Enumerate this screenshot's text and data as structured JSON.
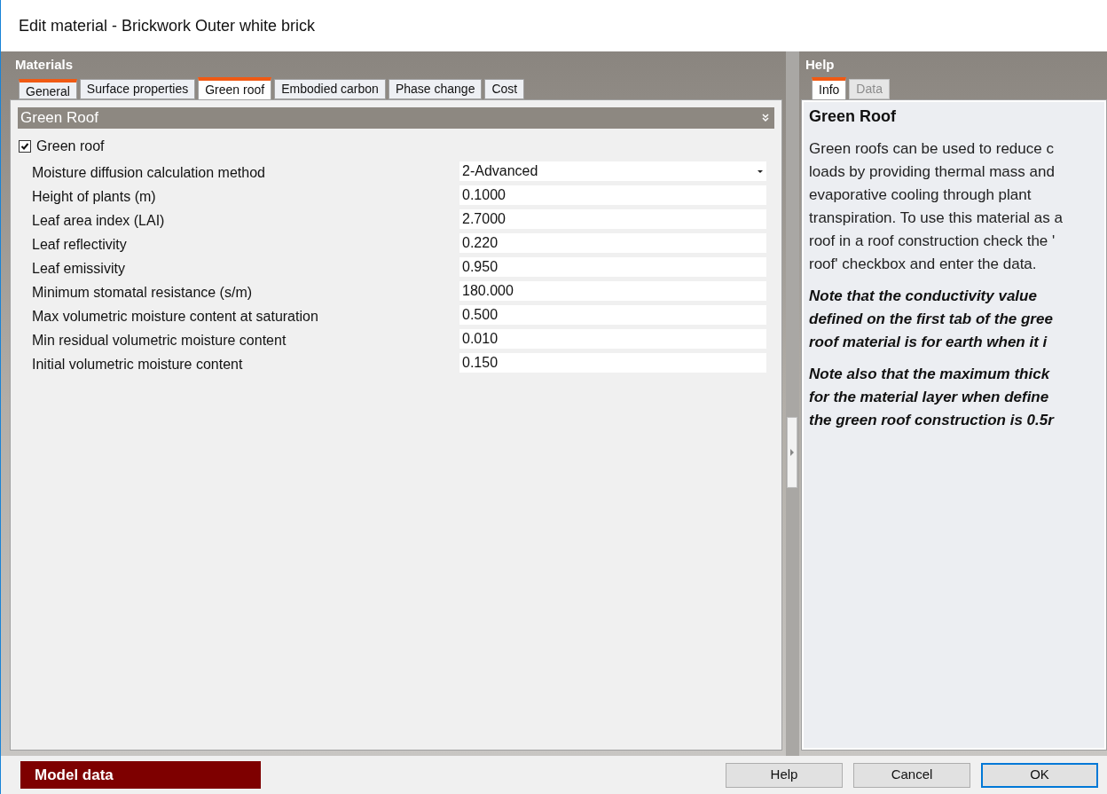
{
  "window": {
    "title": "Edit material - Brickwork Outer white brick"
  },
  "materials": {
    "heading": "Materials",
    "tabs": [
      {
        "label": "General",
        "selected": false,
        "accent": true
      },
      {
        "label": "Surface properties",
        "selected": false,
        "accent": false
      },
      {
        "label": "Green roof",
        "selected": true,
        "accent": true
      },
      {
        "label": "Embodied carbon",
        "selected": false,
        "accent": false
      },
      {
        "label": "Phase change",
        "selected": false,
        "accent": false
      },
      {
        "label": "Cost",
        "selected": false,
        "accent": false
      }
    ],
    "section": {
      "title": "Green Roof",
      "expanded": true
    },
    "green_roof": {
      "label": "Green roof",
      "checked": true
    },
    "fields": [
      {
        "kind": "dropdown",
        "label": "Moisture diffusion calculation method",
        "value": "2-Advanced"
      },
      {
        "kind": "text",
        "label": "Height of plants (m)",
        "value": "0.1000"
      },
      {
        "kind": "text",
        "label": "Leaf area index (LAI)",
        "value": "2.7000"
      },
      {
        "kind": "text",
        "label": "Leaf reflectivity",
        "value": "0.220"
      },
      {
        "kind": "text",
        "label": "Leaf emissivity",
        "value": "0.950"
      },
      {
        "kind": "text",
        "label": "Minimum stomatal resistance (s/m)",
        "value": "180.000"
      },
      {
        "kind": "text",
        "label": "Max volumetric moisture content at saturation",
        "value": "0.500"
      },
      {
        "kind": "text",
        "label": "Min residual volumetric moisture content",
        "value": "0.010"
      },
      {
        "kind": "text",
        "label": "Initial volumetric moisture content",
        "value": "0.150"
      }
    ]
  },
  "help": {
    "heading": "Help",
    "tabs": [
      {
        "label": "Info",
        "selected": true,
        "disabled": false
      },
      {
        "label": "Data",
        "selected": false,
        "disabled": true
      }
    ],
    "title": "Green Roof",
    "paragraphs": [
      {
        "kind": "plain",
        "lines": [
          "Green roofs can be used to reduce c",
          "loads by providing thermal mass and",
          "evaporative cooling through plant",
          "transpiration. To use this material as a",
          "roof in a roof construction check the '",
          "roof' checkbox and enter the data."
        ]
      },
      {
        "kind": "note",
        "lines": [
          "Note that the conductivity value",
          "defined on the first tab of the gree",
          "roof material is for earth when it i"
        ]
      },
      {
        "kind": "note",
        "lines": [
          "Note also that the maximum thick",
          "for the material layer when define",
          "the green roof construction is 0.5r"
        ]
      }
    ]
  },
  "footer": {
    "badge": "Model data",
    "buttons": [
      {
        "label": "Help",
        "default": false
      },
      {
        "label": "Cancel",
        "default": false
      },
      {
        "label": "OK",
        "default": true
      }
    ]
  }
}
